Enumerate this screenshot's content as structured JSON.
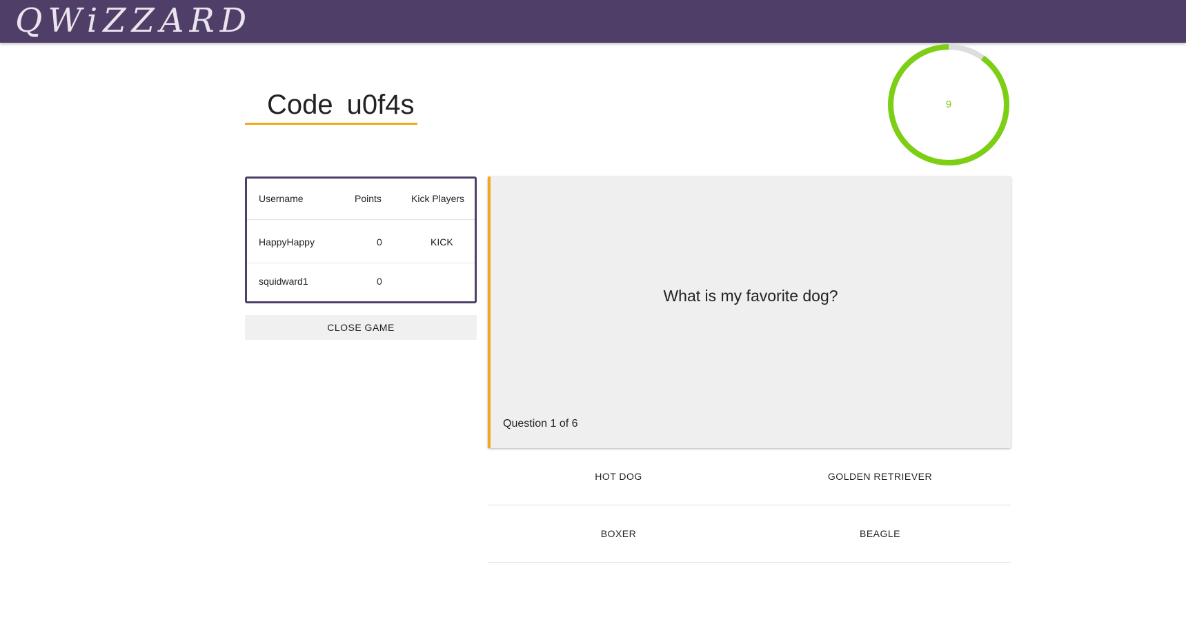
{
  "header": {
    "logo_text": "QWiZZARD",
    "bar_color": "#4f3f68"
  },
  "game": {
    "code_label": "Code",
    "code_value": "u0f4s",
    "accent_color": "#f2a81d"
  },
  "timer": {
    "value": "9",
    "color": "#7ccf14",
    "track_color": "#dddddd",
    "remaining_fraction": 0.9
  },
  "players_table": {
    "headers": {
      "username": "Username",
      "points": "Points",
      "kick": "Kick Players"
    },
    "rows": [
      {
        "username": "HappyHappy",
        "points": "0",
        "kick": "KICK"
      },
      {
        "username": "squidward1",
        "points": "0",
        "kick": ""
      }
    ]
  },
  "close_button": {
    "label": "CLOSE GAME"
  },
  "question": {
    "text": "What is my favorite dog?",
    "progress": "Question 1 of 6"
  },
  "answers": [
    {
      "label": "HOT DOG"
    },
    {
      "label": "GOLDEN RETRIEVER"
    },
    {
      "label": "BOXER"
    },
    {
      "label": "BEAGLE"
    }
  ]
}
